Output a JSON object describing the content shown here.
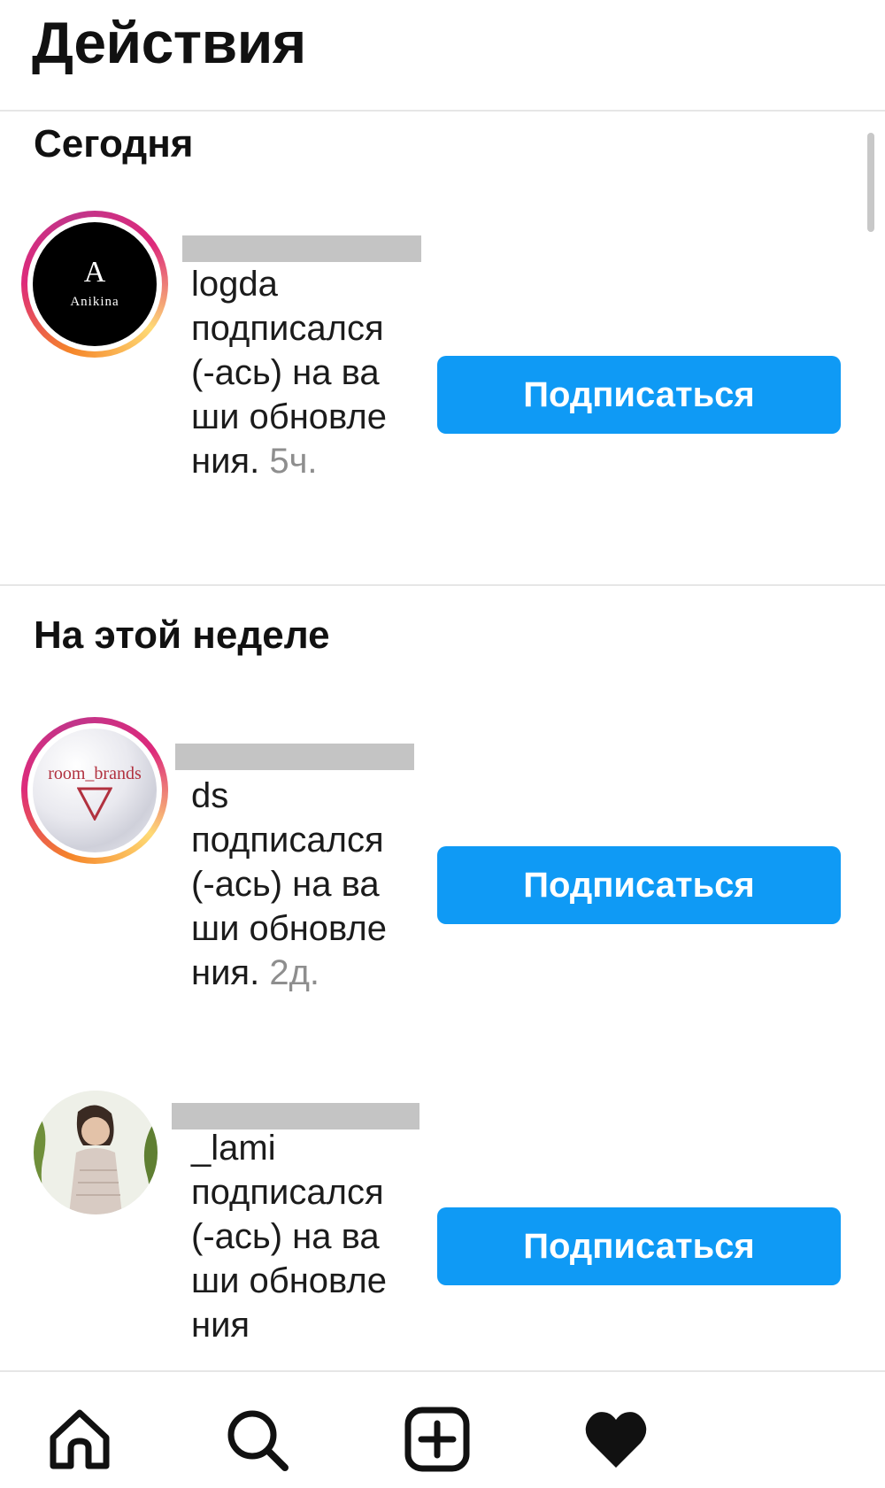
{
  "header": {
    "title": "Действия"
  },
  "sections": [
    {
      "title": "Сегодня"
    },
    {
      "title": "На этой неделе"
    }
  ],
  "notifications": [
    {
      "username_visible": "logda",
      "action": "подписался(-ась) на ваши обновления.",
      "time": "5ч.",
      "button_label": "Подписаться",
      "avatar_label": "Anikina"
    },
    {
      "username_visible": "ds",
      "action": "подписался(-ась) на ваши обновления.",
      "time": "2д.",
      "button_label": "Подписаться",
      "avatar_label": "room_brands"
    },
    {
      "username_visible": "_lami",
      "action": "подписался(-ась) на ваши обновления",
      "time": "",
      "button_label": "Подписаться"
    }
  ],
  "nav": {
    "items": [
      {
        "icon": "home-icon"
      },
      {
        "icon": "search-icon"
      },
      {
        "icon": "add-post-icon"
      },
      {
        "icon": "heart-icon"
      }
    ]
  },
  "colors": {
    "accent": "#0f9af5",
    "divider": "#e6e6e6",
    "muted_text": "#8e8e8e"
  }
}
